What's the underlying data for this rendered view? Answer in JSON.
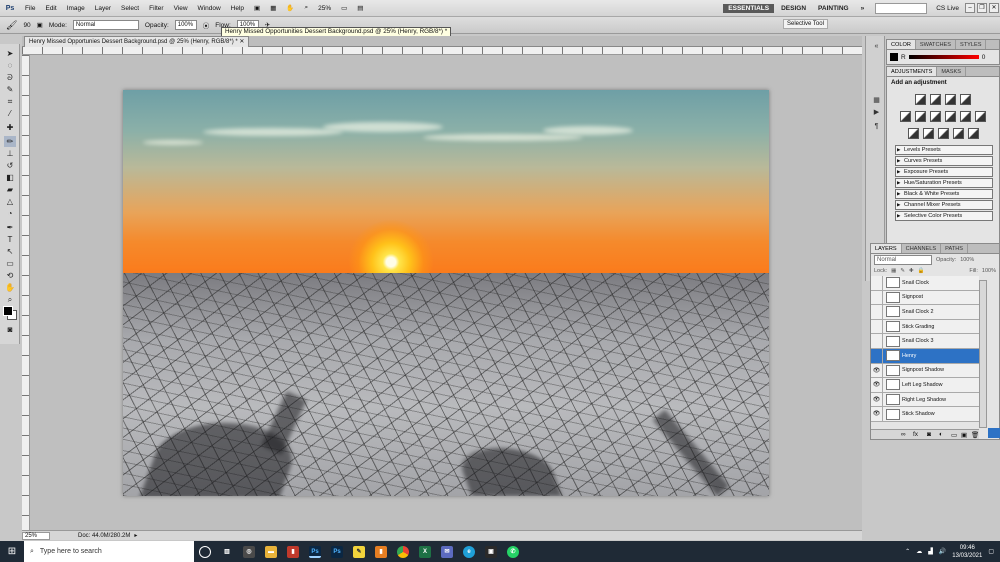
{
  "app": {
    "logo": "Ps",
    "menus": [
      "File",
      "Edit",
      "Image",
      "Layer",
      "Select",
      "Filter",
      "View",
      "Window",
      "Help"
    ],
    "zoom_dropdown": "25%",
    "workspaces": [
      "ESSENTIALS",
      "DESIGN",
      "PAINTING"
    ],
    "active_workspace": "ESSENTIALS",
    "cs_live": "CS Live"
  },
  "options": {
    "brush_size": "90",
    "mode_label": "Mode:",
    "mode_value": "Normal",
    "opacity_label": "Opacity:",
    "opacity_value": "100%",
    "flow_label": "Flow:",
    "flow_value": "100%"
  },
  "tooltip": "Henry Missed Opportunities Dessert Background.psd @ 25% (Henry, RGB/8*) *",
  "tooltip2": "Selective Tool",
  "document": {
    "tab_title": "Henry Missed Opportunies Dessert Background.psd @ 25% (Henry, RGB/8*) *",
    "zoom": "25%",
    "doc_info": "Doc: 44.0M/280.2M"
  },
  "panels": {
    "color_tabs": [
      "COLOR",
      "SWATCHES",
      "STYLES"
    ],
    "color_channel": "R",
    "color_value": "0",
    "adjust_tabs": [
      "ADJUSTMENTS",
      "MASKS"
    ],
    "adjust_title": "Add an adjustment",
    "presets": [
      "Levels Presets",
      "Curves Presets",
      "Exposure Presets",
      "Hue/Saturation Presets",
      "Black & White Presets",
      "Channel Mixer Presets",
      "Selective Color Presets"
    ],
    "layer_tabs": [
      "LAYERS",
      "CHANNELS",
      "PATHS"
    ],
    "blend_mode": "Normal",
    "opacity_label": "Opacity:",
    "opacity_value": "100%",
    "lock_label": "Lock:",
    "fill_label": "Fill:",
    "fill_value": "100%"
  },
  "layers": [
    {
      "name": "Snail Clock",
      "visible": false,
      "selected": false
    },
    {
      "name": "Signpost",
      "visible": false,
      "selected": false
    },
    {
      "name": "Snail Clock 2",
      "visible": false,
      "selected": false
    },
    {
      "name": "Stick Grading",
      "visible": false,
      "selected": false
    },
    {
      "name": "Snail Clock 3",
      "visible": false,
      "selected": false
    },
    {
      "name": "Henry",
      "visible": false,
      "selected": true
    },
    {
      "name": "Signpost Shadow",
      "visible": true,
      "selected": false
    },
    {
      "name": "Left Leg Shadow",
      "visible": true,
      "selected": false
    },
    {
      "name": "Right Leg Shadow",
      "visible": true,
      "selected": false
    },
    {
      "name": "Stick Shadow",
      "visible": true,
      "selected": false
    }
  ],
  "taskbar": {
    "search_placeholder": "Type here to search",
    "time": "09:46",
    "date": "13/03/2021"
  }
}
